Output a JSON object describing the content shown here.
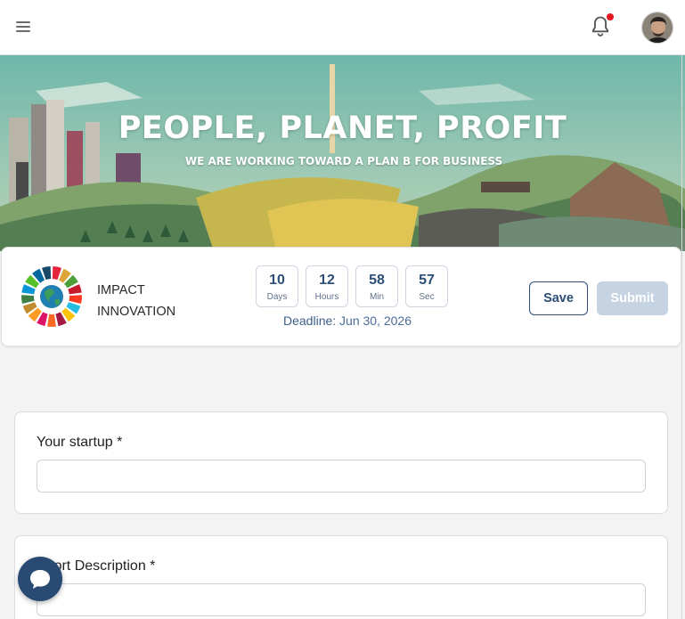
{
  "header": {
    "menu_icon": "hamburger-icon",
    "notification_icon": "bell-icon",
    "has_unread_notifications": true,
    "avatar": "user-avatar"
  },
  "banner": {
    "title": "PEOPLE, PLANET, PROFIT",
    "subtitle": "WE ARE WORKING TOWARD A PLAN B FOR BUSINESS"
  },
  "program": {
    "logo": "sdg-wheel-icon",
    "name": "IMPACT INNOVATION",
    "countdown": [
      {
        "value": "10",
        "unit": "Days"
      },
      {
        "value": "12",
        "unit": "Hours"
      },
      {
        "value": "58",
        "unit": "Min"
      },
      {
        "value": "57",
        "unit": "Sec"
      }
    ],
    "deadline_label": "Deadline:",
    "deadline_date": "Jun 30, 2026",
    "save_label": "Save",
    "submit_label": "Submit"
  },
  "form": {
    "fields": [
      {
        "label": "Your startup *",
        "value": ""
      },
      {
        "label": "Short Description *",
        "value": ""
      }
    ]
  },
  "chat": {
    "icon": "chat-bubble-icon"
  },
  "colors": {
    "primary": "#2c4e77",
    "disabled": "#c6d3e3",
    "notification": "#e5171f"
  }
}
